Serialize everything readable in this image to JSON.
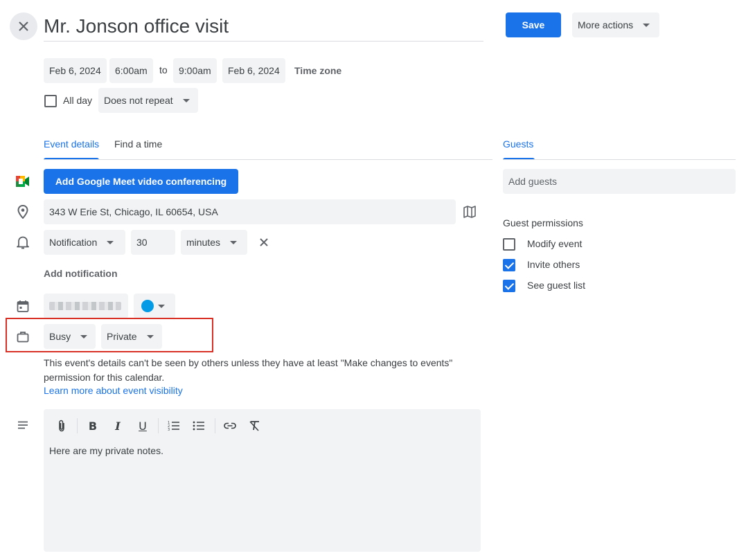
{
  "header": {
    "title": "Mr. Jonson office visit",
    "save_label": "Save",
    "more_actions_label": "More actions"
  },
  "datetime": {
    "start_date": "Feb 6, 2024",
    "start_time": "6:00am",
    "to_label": "to",
    "end_time": "9:00am",
    "end_date": "Feb 6, 2024",
    "timezone_label": "Time zone",
    "all_day_label": "All day",
    "repeat_value": "Does not repeat"
  },
  "tabs": {
    "event_details": "Event details",
    "find_a_time": "Find a time",
    "guests": "Guests"
  },
  "details": {
    "meet_button": "Add Google Meet video conferencing",
    "location": "343 W Erie St, Chicago, IL 60654, USA",
    "notification_type": "Notification",
    "notification_amount": "30",
    "notification_unit": "minutes",
    "add_notification": "Add notification",
    "calendar_color": "#039be5",
    "busy_value": "Busy",
    "visibility_value": "Private",
    "visibility_note_line1": "This event's details can't be seen by others unless they have at least \"Make changes to events\"",
    "visibility_note_line2": "permission for this calendar.",
    "learn_more": "Learn more about event visibility",
    "description": "Here are my private notes."
  },
  "guests": {
    "add_placeholder": "Add guests",
    "permissions_title": "Guest permissions",
    "permissions": [
      {
        "label": "Modify event",
        "checked": false
      },
      {
        "label": "Invite others",
        "checked": true
      },
      {
        "label": "See guest list",
        "checked": true
      }
    ]
  },
  "colors": {
    "accent": "#1a73e8",
    "highlight_box": "#d93025"
  }
}
